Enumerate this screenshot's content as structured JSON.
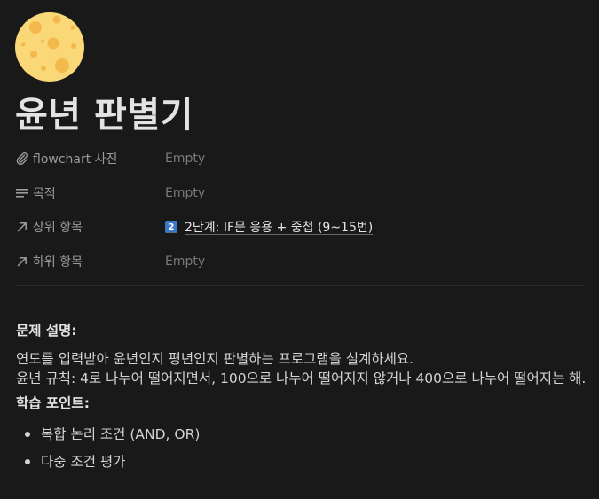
{
  "page": {
    "icon": "cheese-moon-icon",
    "title": "윤년 판별기"
  },
  "properties": [
    {
      "icon": "paperclip-icon",
      "name": "flowchart 사진",
      "value": "Empty",
      "empty": true
    },
    {
      "icon": "text-lines-icon",
      "name": "목적",
      "value": "Empty",
      "empty": true
    },
    {
      "icon": "relation-arrow-icon",
      "name": "상위 항목",
      "badge": "2",
      "value": "2단계: IF문 응용 + 중첩 (9~15번)",
      "empty": false
    },
    {
      "icon": "relation-arrow-icon",
      "name": "하위 항목",
      "value": "Empty",
      "empty": true
    }
  ],
  "content": {
    "problem_heading": "문제 설명:",
    "problem_lines": [
      "연도를 입력받아 윤년인지 평년인지 판별하는 프로그램을 설계하세요.",
      "윤년 규칙: 4로 나누어 떨어지면서, 100으로 나누어 떨어지지 않거나 400으로 나누어 떨어지는 해."
    ],
    "learning_heading": "학습 포인트:",
    "learning_points": [
      "복합 논리 조건 (AND, OR)",
      "다중 조건 평가"
    ]
  },
  "colors": {
    "background": "#191919",
    "icon_fill": "#f8d776",
    "icon_spots": "#f0b84a",
    "badge": "#3a78c8"
  }
}
